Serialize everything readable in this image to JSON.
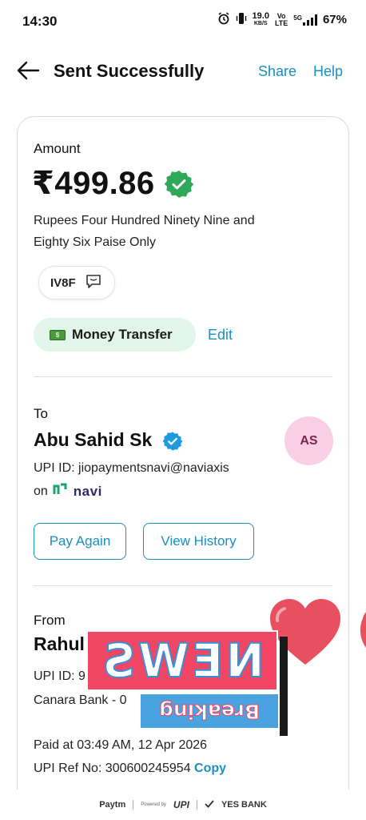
{
  "status_bar": {
    "time": "14:30",
    "speed_value": "19.0",
    "speed_unit": "KB/S",
    "volte_top": "Vo",
    "volte_bottom": "LTE",
    "network": "5G",
    "battery": "67%"
  },
  "header": {
    "title": "Sent Successfully",
    "share_label": "Share",
    "help_label": "Help"
  },
  "amount": {
    "label": "Amount",
    "value": "₹499.86",
    "words": "Rupees Four Hundred Ninety Nine and Eighty Six Paise Only",
    "code": "IV8F",
    "category": "Money Transfer",
    "edit_label": "Edit"
  },
  "payee": {
    "label": "To",
    "name": "Abu Sahid Sk",
    "initials": "AS",
    "upi_id": "UPI ID: jiopaymentsnavi@naviaxis",
    "on_label": "on",
    "app_name": "navi",
    "pay_again_label": "Pay Again",
    "view_history_label": "View History"
  },
  "sender": {
    "label": "From",
    "name": "Rahul",
    "upi_id": "UPI ID: 9",
    "bank": "Canara Bank - 0"
  },
  "transaction": {
    "paid_at": "Paid at 03:49 AM, 12 Apr 2026",
    "ref_label": "UPI Ref No: 300600245954",
    "copy_label": "Copy"
  },
  "footer": {
    "paytm": "Paytm",
    "powered_by": "Powered by",
    "upi": "UPI",
    "bank": "YES BANK"
  },
  "overlay": {
    "news": "NEWS",
    "breaking": "Breaking"
  },
  "colors": {
    "accent": "#1a8fc2",
    "verified_green": "#2fa85a",
    "verified_blue": "#1e9be0",
    "chip_green_bg": "#e3f4ea",
    "avatar_bg": "#f9cfe6"
  }
}
